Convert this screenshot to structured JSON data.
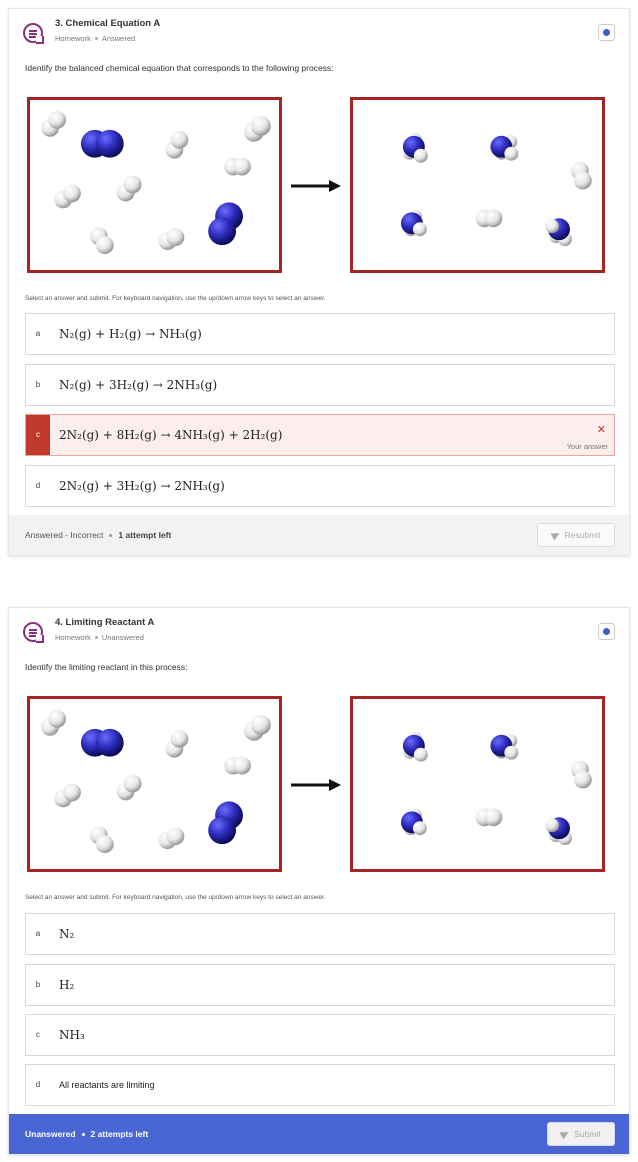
{
  "questions": [
    {
      "title": "3. Chemical Equation A",
      "category": "Homework",
      "state": "Answered",
      "prompt": "Identify the balanced chemical equation that corresponds to the following process:",
      "instructions": "Select an answer and submit. For keyboard navigation, use the up/down arrow keys to select an answer.",
      "options": [
        {
          "letter": "a",
          "text": "N₂(g) + H₂(g) → NH₃(g)"
        },
        {
          "letter": "b",
          "text": "N₂(g) + 3H₂(g) → 2NH₃(g)"
        },
        {
          "letter": "c",
          "text": "2N₂(g) + 8H₂(g) → 4NH₃(g) + 2H₂(g)",
          "note": "Your answer",
          "selected": true,
          "status": "incorrect"
        },
        {
          "letter": "d",
          "text": "2N₂(g) + 3H₂(g) → 2NH₃(g)"
        }
      ],
      "footer": {
        "status": "Answered - Incorrect",
        "attempts": "1 attempt left",
        "button": "Resubmit"
      }
    },
    {
      "title": "4. Limiting Reactant A",
      "category": "Homework",
      "state": "Unanswered",
      "prompt": "Identify the limiting reactant in this process:",
      "instructions": "Select an answer and submit. For keyboard navigation, use the up/down arrow keys to select an answer.",
      "options": [
        {
          "letter": "a",
          "text": "N₂"
        },
        {
          "letter": "b",
          "text": "H₂"
        },
        {
          "letter": "c",
          "text": "NH₃"
        },
        {
          "letter": "d",
          "text": "All reactants are limiting"
        }
      ],
      "footer": {
        "status": "Unanswered",
        "attempts": "2 attempts left",
        "button": "Submit"
      }
    }
  ],
  "colors": {
    "accent": "#4a66d4",
    "incorrect": "#c0392b",
    "frame": "#a42521",
    "question-icon": "#8b2f7d",
    "nitrogen": "#2a2ab8",
    "hydrogen": "#ececec"
  },
  "icons": [
    "question-list-icon",
    "info-icon",
    "close-icon",
    "send-icon",
    "arrow-right-icon"
  ]
}
